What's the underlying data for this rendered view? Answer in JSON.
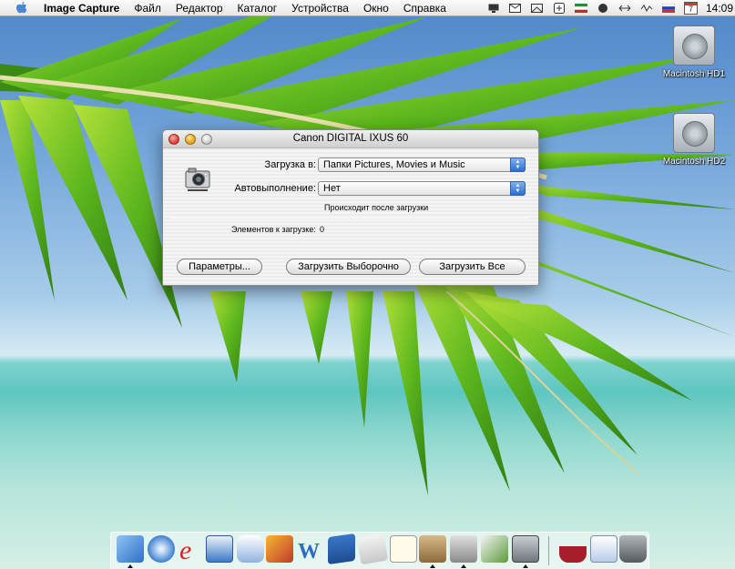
{
  "menubar": {
    "app_name": "Image Capture",
    "items": [
      "Файл",
      "Редактор",
      "Каталог",
      "Устройства",
      "Окно",
      "Справка"
    ],
    "extras": [
      "display-icon",
      "mail-icon",
      "envelope-icon",
      "plus-icon",
      "flag-icon",
      "dot-icon",
      "sync-icon",
      "wifi-icon",
      "russian-flag-icon",
      "calendar-icon"
    ],
    "calendar_day": "7",
    "clock": "14:09"
  },
  "desktop": {
    "drives": [
      {
        "label": "Macintosh HD1"
      },
      {
        "label": "Macintosh HD2"
      }
    ]
  },
  "window": {
    "title": "Canon DIGITAL IXUS 60",
    "download_to_label": "Загрузка в:",
    "download_to_value": "Папки Pictures, Movies и Music",
    "autolaunch_label": "Автовыполнение:",
    "autolaunch_value": "Нет",
    "hint": "Происходит после загрузки",
    "items_label": "Элементов к загрузке:",
    "items_count": "0",
    "buttons": {
      "options": "Параметры...",
      "download_some": "Загрузить Выборочно",
      "download_all": "Загрузить Все"
    }
  },
  "dock": {
    "items": [
      "finder-icon",
      "safari-icon",
      "internet-explorer-icon",
      "mail-icon",
      "ichat-icon",
      "photos-icon",
      "word-icon",
      "book-icon",
      "notepad-icon",
      "textedit-icon",
      "package-icon",
      "tools-icon",
      "pen-icon",
      "image-capture-icon",
      "wine-icon",
      "window-icon",
      "trash-icon"
    ]
  },
  "colors": {
    "accent": "#2b6fd6",
    "close": "#e0443a",
    "minimize": "#e6a520"
  }
}
